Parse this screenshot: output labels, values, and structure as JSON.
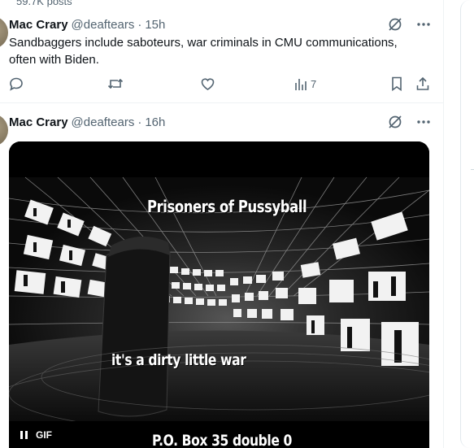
{
  "top_stats": "59.7K posts",
  "tweets": [
    {
      "name": "Mac Crary",
      "handle": "@deaftears",
      "sep": "·",
      "time": "15h",
      "text": "Sandbaggers include saboteurs, war criminals in CMU communications, often with Biden.",
      "views": "7"
    },
    {
      "name": "Mac Crary",
      "handle": "@deaftears",
      "sep": "·",
      "time": "16h",
      "media": {
        "caption_top": "Prisoners of Pussyball",
        "caption_mid": "it's a dirty  little war",
        "caption_bottom": "P.O. Box 35 double 0",
        "gif_label": "GIF"
      }
    }
  ],
  "icons": {
    "grok": "grok-icon",
    "more": "more-icon",
    "reply": "reply-icon",
    "repost": "repost-icon",
    "like": "like-icon",
    "views": "views-icon",
    "bookmark": "bookmark-icon",
    "share": "share-icon",
    "pause": "pause-icon"
  },
  "colors": {
    "text": "#0f1419",
    "secondary": "#536471",
    "border": "#eff3f4"
  }
}
